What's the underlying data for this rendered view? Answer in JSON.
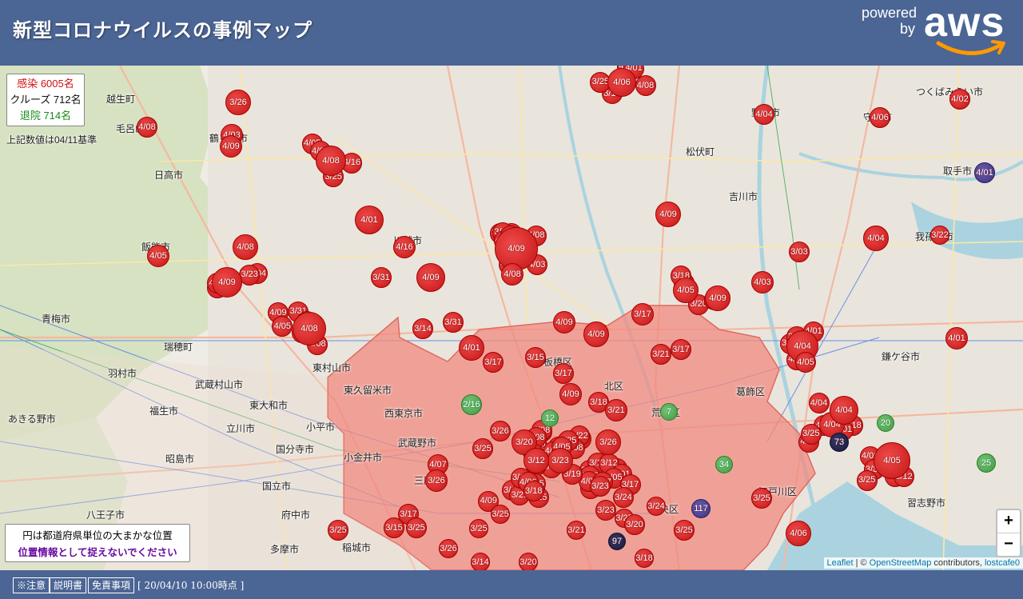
{
  "header": {
    "title": "新型コロナウイルスの事例マップ"
  },
  "aws_logo": {
    "powered": "powered",
    "by": "by",
    "brand": "aws",
    "color_smile": "#f90"
  },
  "stats": {
    "infected": "感染 6005名",
    "cruise": "クルーズ 712名",
    "recovered": "退院 714名",
    "basis": "上記数値は04/11基準"
  },
  "note": {
    "line1": "円は都道府県単位の大まかな位置",
    "line2": "位置情報として捉えないでください"
  },
  "zoom": {
    "in": "+",
    "out": "−"
  },
  "attribution": {
    "leaflet": "Leaflet",
    "sep": " | © ",
    "osm": "OpenStreetMap",
    "contrib": " contributors, ",
    "author": "lostcafe0"
  },
  "footer": {
    "caution": "※注意",
    "manual": "説明書",
    "disclaimer": "免責事項",
    "timestamp": "[ 20/04/10 10:00時点 ]"
  },
  "colors": {
    "header": "#4b6594",
    "case": "#d01010",
    "recovered": "#3e9a3e",
    "tokyo_fill": "#f28a80"
  },
  "place_names": [
    "日高市",
    "飯能市",
    "青梅市",
    "羽村市",
    "武蔵村山市",
    "東村山市",
    "東久留米市",
    "西東京市",
    "武蔵野市",
    "小金井市",
    "国分寺市",
    "立川市",
    "昭島市",
    "福生市",
    "あきる野市",
    "八王子市",
    "国立市",
    "府中市",
    "多摩市",
    "稲城市",
    "東大和市",
    "小平市",
    "三鷹市",
    "吉川市",
    "松伏町",
    "葛飾区",
    "江戸川区",
    "中央区",
    "北区",
    "鎌ケ谷市",
    "取手市",
    "つくばみらい市",
    "我孫子市",
    "守谷市",
    "野田市",
    "川越市",
    "鶴ヶ島市",
    "瑞穂町",
    "毛呂山町",
    "越生町",
    "板橋区",
    "荒川区",
    "習志野市"
  ],
  "markers": [
    {
      "label": "4/08",
      "t": "r"
    },
    {
      "label": "4/06",
      "t": "r"
    },
    {
      "label": "3/26",
      "t": "r"
    },
    {
      "label": "4/03",
      "t": "r"
    },
    {
      "label": "4/09",
      "t": "r"
    },
    {
      "label": "4/08",
      "t": "r"
    },
    {
      "label": "4/05",
      "t": "r"
    },
    {
      "label": "4/09",
      "t": "r"
    },
    {
      "label": "4/08",
      "t": "r"
    },
    {
      "label": "4/08",
      "t": "r"
    },
    {
      "label": "4/01",
      "t": "r"
    },
    {
      "label": "4/16",
      "t": "r"
    },
    {
      "label": "3/31",
      "t": "r"
    },
    {
      "label": "4/09",
      "t": "r"
    },
    {
      "label": "3/14",
      "t": "r"
    },
    {
      "label": "3/31",
      "t": "r"
    },
    {
      "label": "4/01",
      "t": "r"
    },
    {
      "label": "3/17",
      "t": "r"
    },
    {
      "label": "4/09",
      "t": "r"
    },
    {
      "label": "4/08",
      "t": "r"
    },
    {
      "label": "4/06",
      "t": "r"
    },
    {
      "label": "4/04",
      "t": "r"
    },
    {
      "label": "4/09",
      "t": "r"
    },
    {
      "label": "4/09",
      "t": "r"
    },
    {
      "label": "4/05",
      "t": "r"
    },
    {
      "label": "3/17",
      "t": "r"
    },
    {
      "label": "3/21",
      "t": "r"
    },
    {
      "label": "3/17",
      "t": "r"
    },
    {
      "label": "3/15",
      "t": "r"
    },
    {
      "label": "3/17",
      "t": "r"
    },
    {
      "label": "4/09",
      "t": "r"
    },
    {
      "label": "3/18",
      "t": "r"
    },
    {
      "label": "3/25",
      "t": "r"
    },
    {
      "label": "3/26",
      "t": "r"
    },
    {
      "label": "4/07",
      "t": "r"
    },
    {
      "label": "3/26",
      "t": "r"
    },
    {
      "label": "3/17",
      "t": "r"
    },
    {
      "label": "3/25",
      "t": "r"
    },
    {
      "label": "3/15",
      "t": "r"
    },
    {
      "label": "3/25",
      "t": "r"
    },
    {
      "label": "3/26",
      "t": "r"
    },
    {
      "label": "3/14",
      "t": "r"
    },
    {
      "label": "3/20",
      "t": "r"
    },
    {
      "label": "3/19",
      "t": "r"
    },
    {
      "label": "3/23",
      "t": "r"
    },
    {
      "label": "3/21",
      "t": "r"
    },
    {
      "label": "3/25",
      "t": "r"
    },
    {
      "label": "3/24",
      "t": "r"
    },
    {
      "label": "3/25",
      "t": "r"
    },
    {
      "label": "3/18",
      "t": "r"
    },
    {
      "label": "3/25",
      "t": "r"
    },
    {
      "label": "3/25",
      "t": "r"
    },
    {
      "label": "4/06",
      "t": "r"
    },
    {
      "label": "4/04",
      "t": "r"
    },
    {
      "label": "4/05",
      "t": "r"
    },
    {
      "label": "3/25",
      "t": "r"
    },
    {
      "label": "4/01",
      "t": "r"
    },
    {
      "label": "4/02",
      "t": "r"
    },
    {
      "label": "3/22",
      "t": "r"
    },
    {
      "label": "4/04",
      "t": "r"
    },
    {
      "label": "3/03",
      "t": "r"
    },
    {
      "label": "4/03",
      "t": "r"
    },
    {
      "label": "4/04",
      "t": "r"
    },
    {
      "label": "4/05",
      "t": "r"
    },
    {
      "label": "4/04",
      "t": "r"
    },
    {
      "label": "3/20",
      "t": "r"
    },
    {
      "label": "3/23",
      "t": "r"
    },
    {
      "label": "3/12",
      "t": "r"
    },
    {
      "label": "3/26",
      "t": "r"
    },
    {
      "label": "3/21",
      "t": "r"
    },
    {
      "label": "2/16",
      "t": "g"
    },
    {
      "label": "20",
      "t": "g"
    },
    {
      "label": "25",
      "t": "g"
    },
    {
      "label": "34",
      "t": "g"
    },
    {
      "label": "7",
      "t": "g"
    },
    {
      "label": "12",
      "t": "g"
    },
    {
      "label": "73",
      "t": "k"
    },
    {
      "label": "117",
      "t": "p"
    },
    {
      "label": "97",
      "t": "k"
    },
    {
      "label": "4/01",
      "t": "p"
    },
    {
      "label": "4/09",
      "t": "r"
    },
    {
      "label": "4/09",
      "t": "r"
    },
    {
      "label": "3/24",
      "t": "r"
    },
    {
      "label": "3/23",
      "t": "r"
    },
    {
      "label": "3/20",
      "t": "r"
    }
  ]
}
